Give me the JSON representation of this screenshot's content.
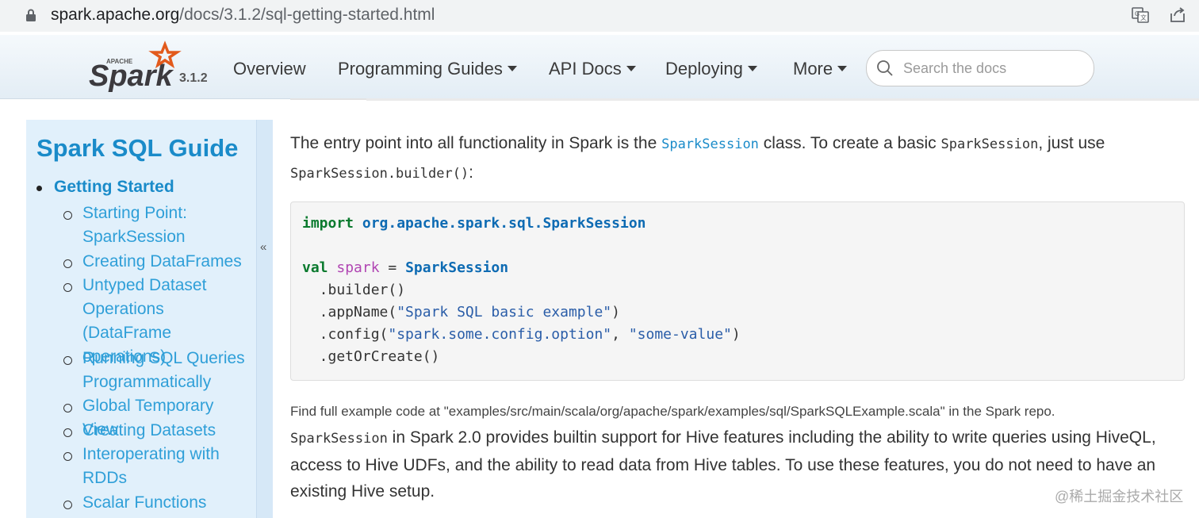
{
  "browser": {
    "url_host": "spark.apache.org",
    "url_path": "/docs/3.1.2/sql-getting-started.html"
  },
  "navbar": {
    "logo_text": "Spark",
    "logo_small": "APACHE",
    "version": "3.1.2",
    "items": [
      {
        "label": "Overview",
        "dropdown": false
      },
      {
        "label": "Programming Guides",
        "dropdown": true
      },
      {
        "label": "API Docs",
        "dropdown": true
      },
      {
        "label": "Deploying",
        "dropdown": true
      },
      {
        "label": "More",
        "dropdown": true
      }
    ],
    "search_placeholder": "Search the docs"
  },
  "sidebar": {
    "title": "Spark SQL Guide",
    "section": "Getting Started",
    "collapse_glyph": "«",
    "items": [
      [
        "Starting Point:",
        "SparkSession"
      ],
      [
        "Creating DataFrames"
      ],
      [
        "Untyped Dataset",
        "Operations (DataFrame",
        "operations)"
      ],
      [
        "Running SQL Queries",
        "Programmatically"
      ],
      [
        "Global Temporary View"
      ],
      [
        "Creating Datasets"
      ],
      [
        "Interoperating with",
        "RDDs"
      ],
      [
        "Scalar Functions"
      ]
    ]
  },
  "content": {
    "para1_a": "The entry point into all functionality in Spark is the ",
    "para1_link": "SparkSession",
    "para1_b": " class. To create a basic ",
    "para1_code1": "SparkSession",
    "para1_c": ", just use",
    "para1_code2": "SparkSession.builder()",
    "para1_d": ":",
    "code": {
      "l1_kw": "import",
      "l1_pkg": "org.apache.spark.sql.SparkSession",
      "l2_kw": "val",
      "l2_var": "spark",
      "l2_eq": " = ",
      "l2_cls": "SparkSession",
      "l3": "  .builder()",
      "l4_a": "  .appName(",
      "l4_s": "\"Spark SQL basic example\"",
      "l4_b": ")",
      "l5_a": "  .config(",
      "l5_s1": "\"spark.some.config.option\"",
      "l5_m": ", ",
      "l5_s2": "\"some-value\"",
      "l5_b": ")",
      "l6": "  .getOrCreate()"
    },
    "note": "Find full example code at \"examples/src/main/scala/org/apache/spark/examples/sql/SparkSQLExample.scala\" in the Spark repo.",
    "para2_code": "SparkSession",
    "para2_text": " in Spark 2.0 provides builtin support for Hive features including the ability to write queries using HiveQL, access to Hive UDFs, and the ability to read data from Hive tables. To use these features, you do not need to have an existing Hive setup."
  },
  "watermark": "@稀土掘金技术社区"
}
